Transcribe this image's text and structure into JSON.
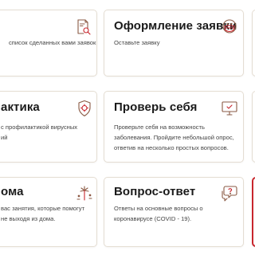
{
  "colors": {
    "card_border": "#e4ddd2",
    "icon_stroke": "#8a5a44",
    "icon_accent": "#c8262d",
    "active_border": "#c8262d",
    "title": "#1a1a1a",
    "text": "#444444"
  },
  "cards": {
    "left_top": {
      "title": "",
      "description": "список сделанных вами заявок",
      "icon": "document-magnify-icon"
    },
    "mid_top": {
      "title": "Оформление заявки",
      "description": "Оставьте заявку",
      "icon": "medical-mask-icon"
    },
    "left_mid": {
      "title": "актика",
      "description": "с профилактикой вирусных\nий",
      "icon": "virus-shield-icon"
    },
    "mid_mid": {
      "title": "Проверь себя",
      "description": "Проверьте себя на возможность\nзаболевания. Пройдите небольшой опрос,\nответив на несколько простых вопросов.",
      "icon": "computer-test-icon"
    },
    "left_bottom": {
      "title": "ома",
      "description": "вас занятия, которые помогут\nне выходя из дома.",
      "icon": "fireworks-icon"
    },
    "mid_bottom": {
      "title": "Вопрос-ответ",
      "description": "Ответы на основные вопросы о\nкоронавирусе (COVID - 19).",
      "icon": "question-chat-icon"
    }
  }
}
